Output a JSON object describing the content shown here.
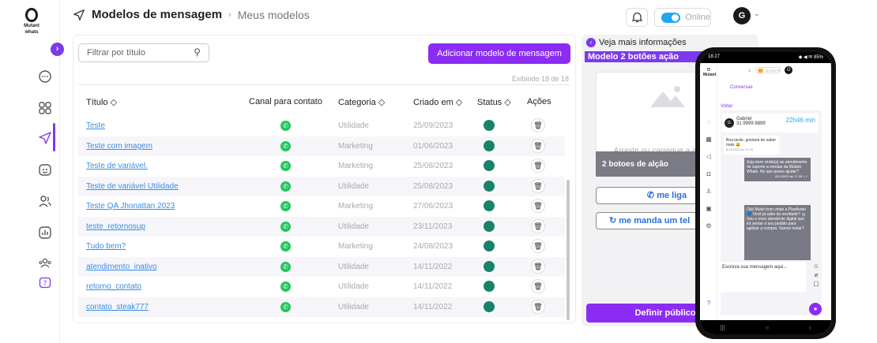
{
  "header": {
    "title": "Modelos de mensagem",
    "breadcrumb_sep": "›",
    "subtitle": "Meus modelos",
    "status_label": "Online",
    "avatar_initial": "G"
  },
  "sidebar": {
    "logo_line1": "Mutant",
    "logo_line2": "whats",
    "expand_glyph": "›"
  },
  "toolbar": {
    "filter_placeholder": "Filtrar por título",
    "add_button": "Adicionar modelo de mensagem",
    "showing": "Exibindo 18 de 18"
  },
  "table": {
    "columns": [
      "Título ◇",
      "Canal para contato",
      "Categoria ◇",
      "Criado em ◇",
      "Status ◇",
      "Ações"
    ],
    "rows": [
      {
        "title": "Teste",
        "category": "Utilidade",
        "date": "25/09/2023"
      },
      {
        "title": "Teste com imagem",
        "category": "Marketing",
        "date": "01/06/2023"
      },
      {
        "title": "Teste de variável.",
        "category": "Marketing",
        "date": "25/08/2023"
      },
      {
        "title": "Teste de variável Utilidade",
        "category": "Utilidade",
        "date": "25/08/2023"
      },
      {
        "title": "Teste QA Jhonattan 2023",
        "category": "Marketing",
        "date": "27/06/2023"
      },
      {
        "title": "teste_retornosup",
        "category": "Utilidade",
        "date": "23/11/2023"
      },
      {
        "title": "Tudo bem?",
        "category": "Marketing",
        "date": "24/08/2023"
      },
      {
        "title": "atendimento_inativo",
        "category": "Utilidade",
        "date": "14/11/2022"
      },
      {
        "title": "retorno_contato",
        "category": "Utilidade",
        "date": "14/11/2022"
      },
      {
        "title": "contato_steak777",
        "category": "Utilidade",
        "date": "14/11/2022"
      }
    ]
  },
  "preview": {
    "more_info": "Veja mais informações",
    "model_name": "Modelo 2 botões ação",
    "upload_text": "Arraste ou carregue a imagem",
    "body_text": "2 botoes de alção",
    "call_button": "me liga",
    "reply_button": "me manda um tel",
    "define_button": "Definir público-a"
  },
  "phone": {
    "clock": "18:27",
    "status_right": "◆ ◀ ✉ 85%",
    "conversas": "Conversas",
    "online_label": "AUSENTE",
    "avatar_initial": "G",
    "voltar": "Voltar",
    "contact_name": "Gabriel",
    "contact_phone": "31 9999 8899",
    "contact_time": "22h46 min",
    "incoming_msg": "Boa tarde, gostaria de saber mais 😀",
    "incoming_time": "8/11/2023 às 17:28",
    "out_msg_1": "Seja bem vindo(a) ao atendimento de suporte a vendas da Mutant Whats. No que posso ajudar?",
    "out_msg_1_time": "8/11/2023 às 17:28 ✓✓",
    "out_msg_2": "Olá! Muito bom vindo a Plasthotel 💙 Você já sabe da novidade? 🤖 Seu o novo atendente digital que irá anotar o seu pedido para agilizar a compra. Vamos testar?",
    "input_placeholder": "Escreva sua mensagem aqui...",
    "nav": [
      "|||",
      "○",
      "‹"
    ]
  }
}
